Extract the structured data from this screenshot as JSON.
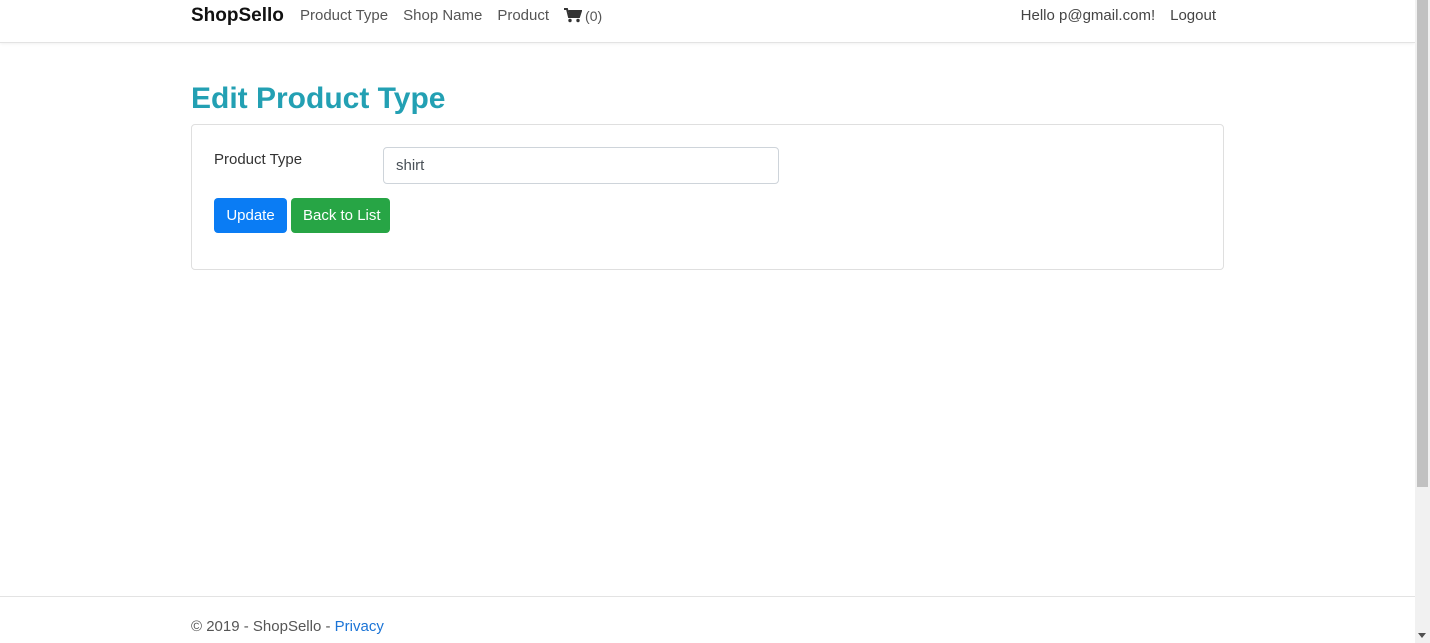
{
  "navbar": {
    "brand": "ShopSello",
    "links": [
      "Product Type",
      "Shop Name",
      "Product"
    ],
    "cart_count": "(0)",
    "greeting": "Hello p@gmail.com!",
    "logout": "Logout"
  },
  "page": {
    "title": "Edit Product Type"
  },
  "form": {
    "label": "Product Type",
    "value": "shirt",
    "update_button": "Update",
    "back_button": "Back to List"
  },
  "footer": {
    "text": "© 2019 - ShopSello - ",
    "link": "Privacy"
  },
  "colors": {
    "title": "#23a0b3",
    "update": "#0a7cf4",
    "back": "#27a545",
    "link": "#1b74d6"
  }
}
